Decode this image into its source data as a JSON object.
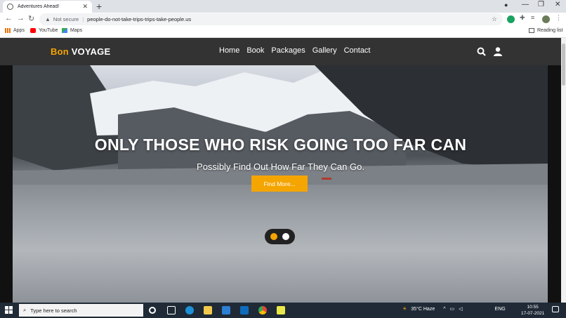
{
  "browser": {
    "tab_title": "Adventures Ahead!",
    "url_status": "Not secure",
    "url": "people-do-not-take-trips-trips-take-people.us",
    "bookmarks": [
      {
        "label": "Apps",
        "icon": "apps-grid-icon"
      },
      {
        "label": "YouTube",
        "icon": "youtube-icon"
      },
      {
        "label": "Maps",
        "icon": "maps-icon"
      }
    ],
    "reading_list": "Reading list"
  },
  "site": {
    "brand_part1": "Bon",
    "brand_part2": "VOYAGE",
    "nav": [
      "Home",
      "Book",
      "Packages",
      "Gallery",
      "Contact"
    ],
    "hero_title": "ONLY THOSE WHO RISK GOING TOO FAR CAN",
    "hero_subtitle": "Possibly Find Out How Far They Can Go.",
    "cta_label": "Find More...",
    "carousel_active_index": 0,
    "carousel_count": 2,
    "colors": {
      "accent": "#f5a500",
      "nav_bg": "#333333"
    }
  },
  "taskbar": {
    "search_placeholder": "Type here to search",
    "weather": "35°C  Haze",
    "language": "ENG",
    "time": "10:55",
    "date": "17-07-2021"
  }
}
